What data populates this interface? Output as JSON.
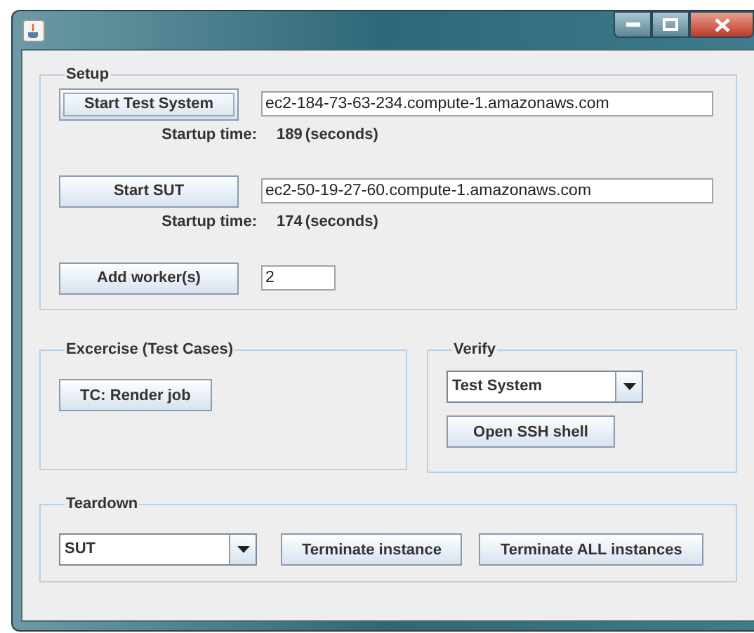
{
  "setup": {
    "title": "Setup",
    "rows": [
      {
        "kind": "host",
        "button": "Start Test System",
        "focused": true,
        "host": "ec2-184-73-63-234.compute-1.amazonaws.com",
        "time_label": "Startup time:",
        "time_value": "189",
        "time_unit": "(seconds)"
      },
      {
        "kind": "host",
        "button": "Start SUT",
        "focused": false,
        "host": "ec2-50-19-27-60.compute-1.amazonaws.com",
        "time_label": "Startup time:",
        "time_value": "174",
        "time_unit": "(seconds)"
      },
      {
        "kind": "workers",
        "button": "Add worker(s)",
        "focused": false,
        "host": "2"
      }
    ]
  },
  "exercise": {
    "title": "Excercise (Test Cases)",
    "buttons": [
      "TC: Render job"
    ]
  },
  "verify": {
    "title": "Verify",
    "dropdown": "Test System",
    "button": "Open SSH shell"
  },
  "teardown": {
    "title": "Teardown",
    "dropdown": "SUT",
    "buttons": [
      "Terminate instance",
      "Terminate ALL instances"
    ]
  }
}
